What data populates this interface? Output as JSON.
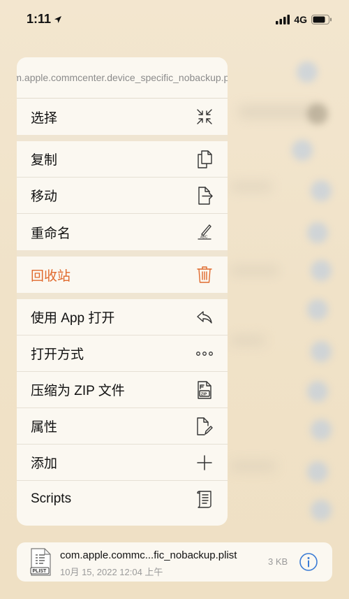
{
  "status": {
    "time": "1:11",
    "network": "4G"
  },
  "menu": {
    "header": "com.apple.commcenter.device_specific_nobackup.plist",
    "groups": [
      [
        {
          "label": "选择",
          "icon": "collapse-arrows-icon"
        }
      ],
      [
        {
          "label": "复制",
          "icon": "copy-icon"
        },
        {
          "label": "移动",
          "icon": "move-icon"
        },
        {
          "label": "重命名",
          "icon": "rename-icon"
        }
      ],
      [
        {
          "label": "回收站",
          "icon": "trash-icon",
          "danger": true
        }
      ],
      [
        {
          "label": "使用 App 打开",
          "icon": "reply-icon"
        },
        {
          "label": "打开方式",
          "icon": "ellipsis-icon"
        },
        {
          "label": "压缩为 ZIP 文件",
          "icon": "zip-file-icon"
        },
        {
          "label": "属性",
          "icon": "edit-file-icon"
        },
        {
          "label": "添加",
          "icon": "plus-icon"
        },
        {
          "label": "Scripts",
          "icon": "script-icon"
        }
      ]
    ]
  },
  "file": {
    "icon_label": "PLIST",
    "name": "com.apple.commc...fic_nobackup.plist",
    "date": "10月 15, 2022 12:04 上午",
    "size": "3 KB"
  },
  "colors": {
    "danger": "#e06a2e",
    "info": "#3a7bd5"
  }
}
